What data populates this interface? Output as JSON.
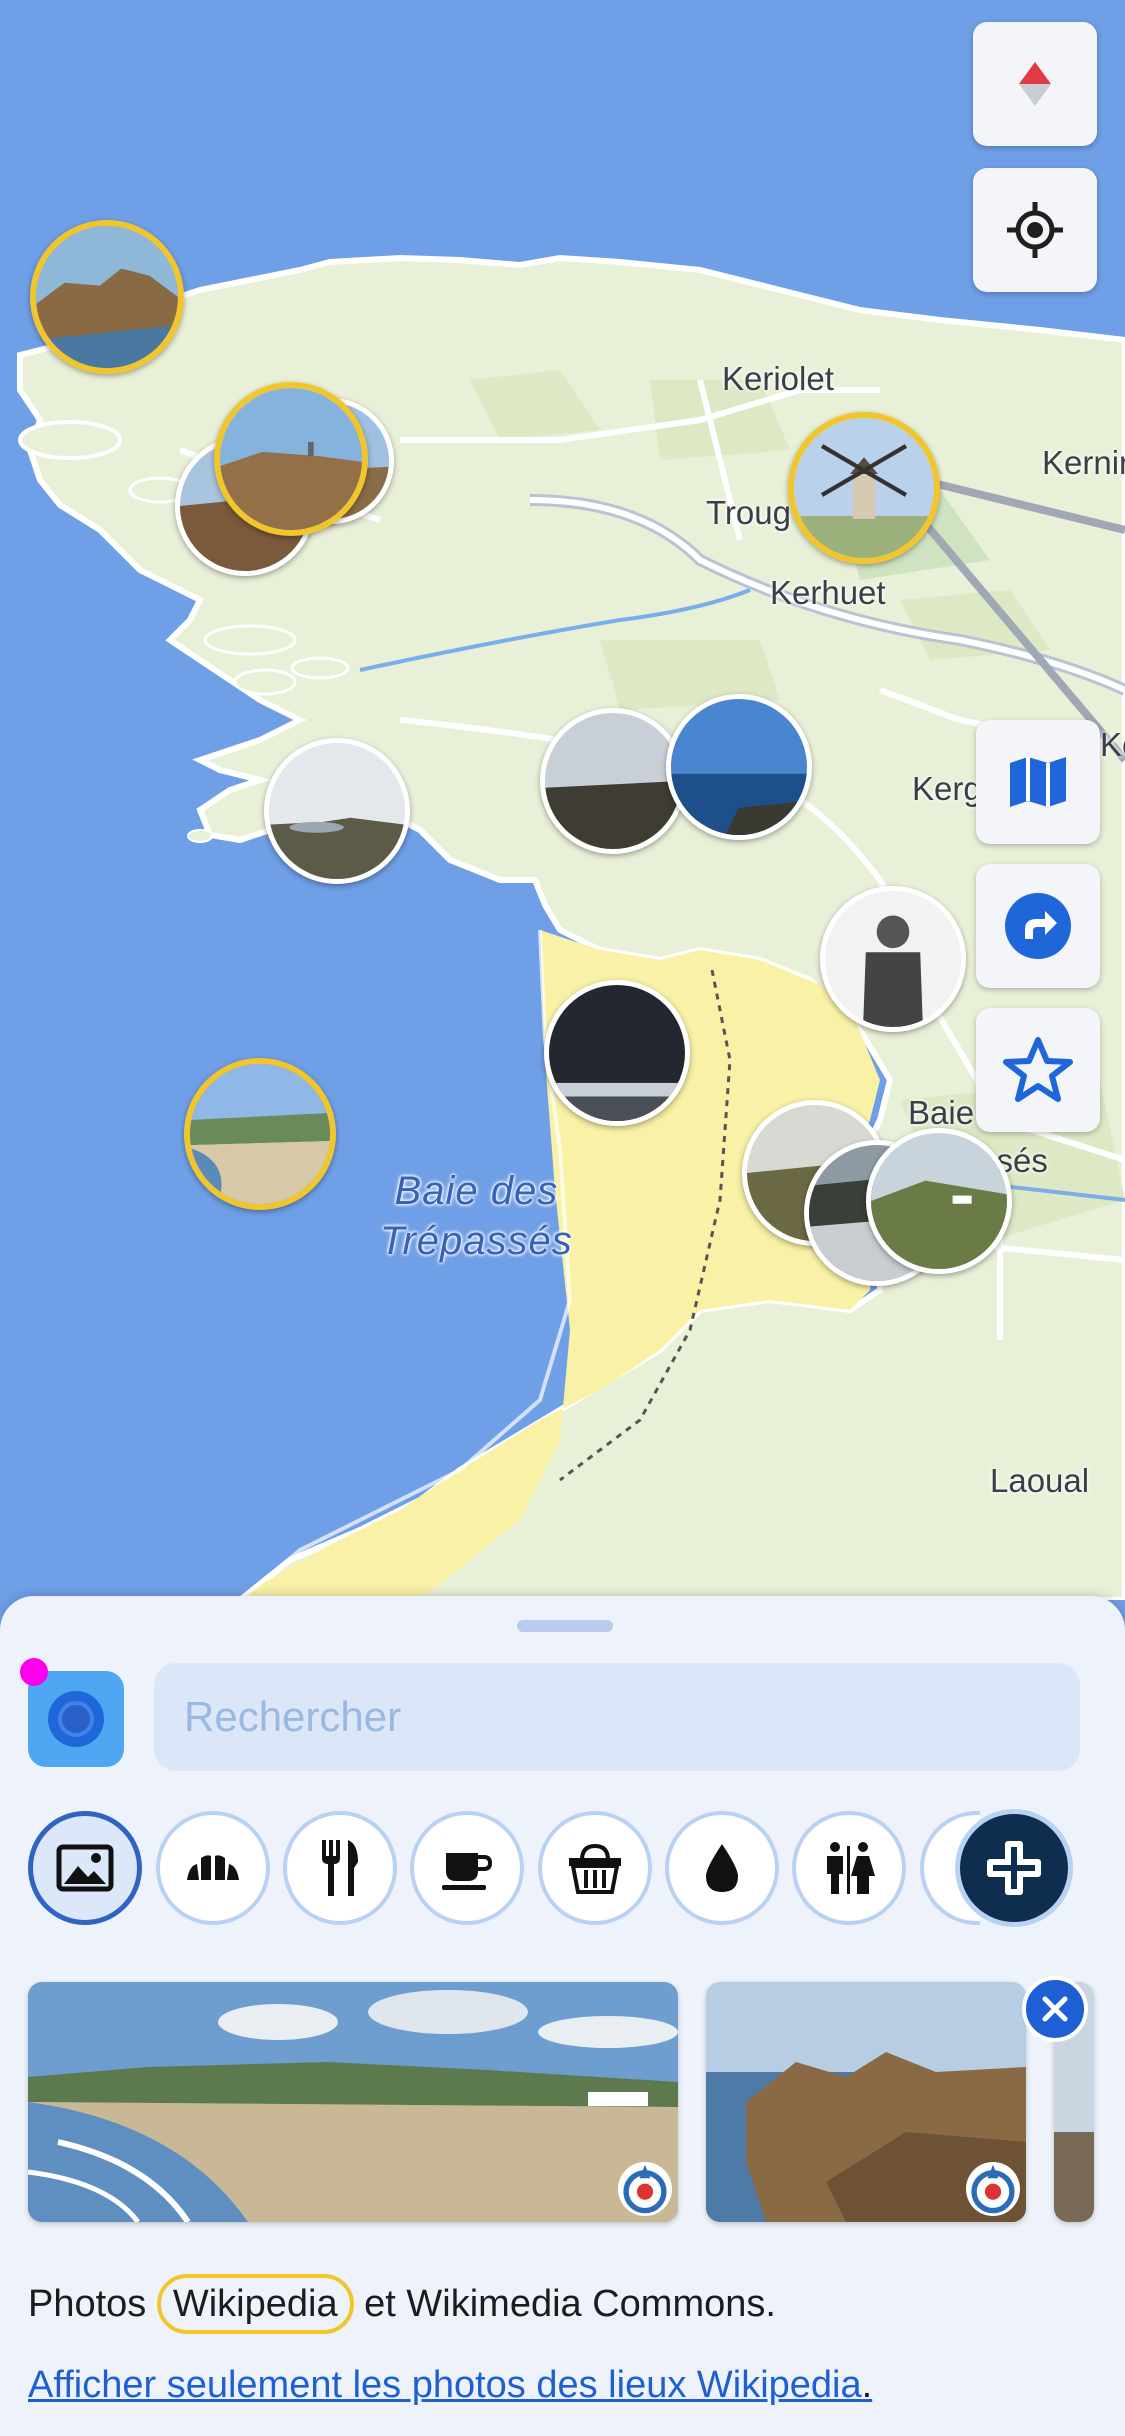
{
  "map": {
    "places": [
      "Keriolet",
      "Kernin",
      "Troug",
      "Kerhuet",
      "Kerg",
      "Ke",
      "Baie",
      "ssés",
      "Laoual"
    ],
    "bay_line1": "Baie des",
    "bay_line2": "Trépassés"
  },
  "controls": {
    "compass_icon": "compass-icon",
    "locate_icon": "locate-icon",
    "map_icon": "map-icon",
    "directions_icon": "directions-icon",
    "favorite_icon": "star-icon"
  },
  "search": {
    "placeholder": "Rechercher"
  },
  "categories": [
    {
      "name": "photos",
      "icon": "image-icon",
      "active": true
    },
    {
      "name": "bakery",
      "icon": "croissant-icon",
      "active": false
    },
    {
      "name": "restaurant",
      "icon": "cutlery-icon",
      "active": false
    },
    {
      "name": "cafe",
      "icon": "cup-icon",
      "active": false
    },
    {
      "name": "shop",
      "icon": "basket-icon",
      "active": false
    },
    {
      "name": "water",
      "icon": "drop-icon",
      "active": false
    },
    {
      "name": "toilets",
      "icon": "toilets-icon",
      "active": false
    },
    {
      "name": "more",
      "icon": "plus-icon",
      "active": false
    }
  ],
  "footer": {
    "text_before": "Photos ",
    "highlight": "Wikipedia",
    "text_after": " et Wikimedia Commons.",
    "link": "Afficher seulement les photos des lieux Wikipedia",
    "link_suffix": "."
  },
  "colors": {
    "accent": "#1f5fd4",
    "sea": "#6f9fe6",
    "land": "#e9f0d8",
    "beach": "#f8f1a6",
    "highlight": "#f1c62c",
    "magenta_dot": "#ff00ee"
  }
}
